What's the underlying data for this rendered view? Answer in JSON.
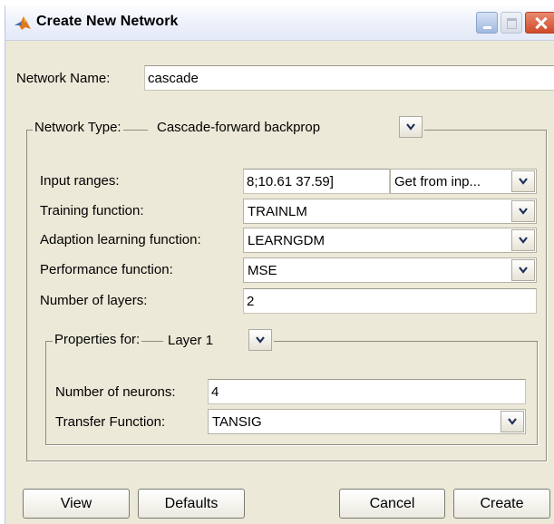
{
  "window": {
    "title": "Create New Network"
  },
  "network_name": {
    "label": "Network Name:",
    "value": "cascade"
  },
  "network_type": {
    "label": "Network Type:",
    "value": "Cascade-forward backprop"
  },
  "input_ranges": {
    "label": "Input ranges:",
    "value": "8;10.61 37.59]",
    "source_value": "Get from inp..."
  },
  "training_function": {
    "label": "Training function:",
    "value": "TRAINLM"
  },
  "adaption_learning_function": {
    "label": "Adaption learning function:",
    "value": "LEARNGDM"
  },
  "performance_function": {
    "label": "Performance function:",
    "value": "MSE"
  },
  "number_of_layers": {
    "label": "Number of layers:",
    "value": "2"
  },
  "properties": {
    "label": "Properties for:",
    "layer_value": "Layer 1",
    "neurons": {
      "label": "Number of neurons:",
      "value": "4"
    },
    "transfer_function": {
      "label": "Transfer Function:",
      "value": "TANSIG"
    }
  },
  "buttons": {
    "view": "View",
    "defaults": "Defaults",
    "cancel": "Cancel",
    "create": "Create"
  },
  "colors": {
    "dialog_bg": "#ece9d8",
    "close_button": "#cf4a2a",
    "accent_icon": "#e07a1f"
  }
}
